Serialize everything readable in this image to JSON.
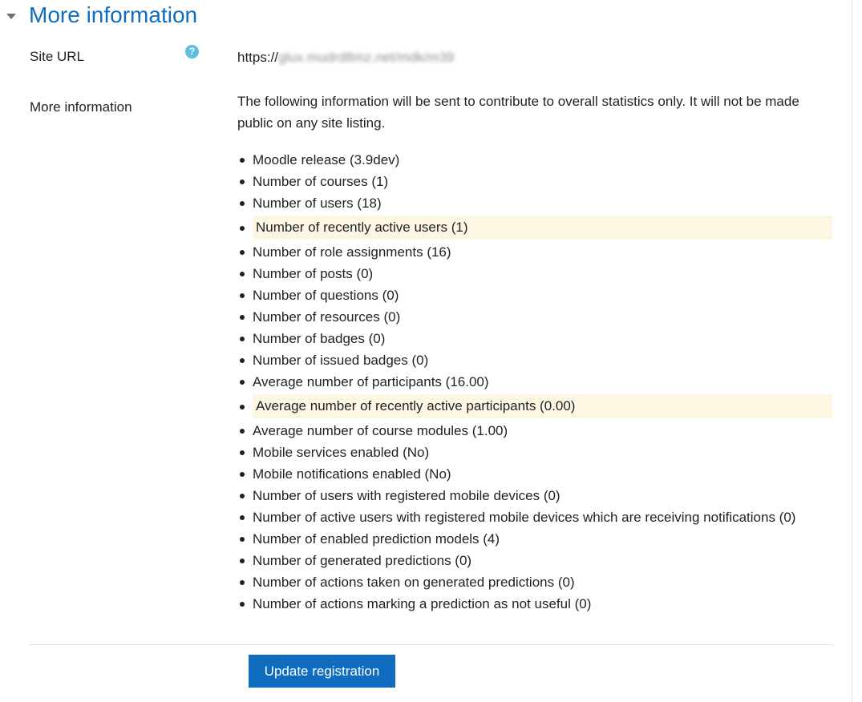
{
  "section": {
    "title": "More information"
  },
  "site_url": {
    "label": "Site URL",
    "prefix": "https://",
    "obscured": "glux.mudrd8mz.net/mdk/m39"
  },
  "more_info": {
    "label": "More information",
    "intro": "The following information will be sent to contribute to overall statistics only. It will not be made public on any site listing.",
    "items": [
      {
        "text": "Moodle release (3.9dev)",
        "highlight": false
      },
      {
        "text": "Number of courses (1)",
        "highlight": false
      },
      {
        "text": "Number of users (18)",
        "highlight": false
      },
      {
        "text": "Number of recently active users (1)",
        "highlight": true
      },
      {
        "text": "Number of role assignments (16)",
        "highlight": false
      },
      {
        "text": "Number of posts (0)",
        "highlight": false
      },
      {
        "text": "Number of questions (0)",
        "highlight": false
      },
      {
        "text": "Number of resources (0)",
        "highlight": false
      },
      {
        "text": "Number of badges (0)",
        "highlight": false
      },
      {
        "text": "Number of issued badges (0)",
        "highlight": false
      },
      {
        "text": "Average number of participants (16.00)",
        "highlight": false
      },
      {
        "text": "Average number of recently active participants (0.00)",
        "highlight": true
      },
      {
        "text": "Average number of course modules (1.00)",
        "highlight": false
      },
      {
        "text": "Mobile services enabled (No)",
        "highlight": false
      },
      {
        "text": "Mobile notifications enabled (No)",
        "highlight": false
      },
      {
        "text": "Number of users with registered mobile devices (0)",
        "highlight": false
      },
      {
        "text": "Number of active users with registered mobile devices which are receiving notifications (0)",
        "highlight": false
      },
      {
        "text": "Number of enabled prediction models (4)",
        "highlight": false
      },
      {
        "text": "Number of generated predictions (0)",
        "highlight": false
      },
      {
        "text": "Number of actions taken on generated predictions (0)",
        "highlight": false
      },
      {
        "text": "Number of actions marking a prediction as not useful (0)",
        "highlight": false
      }
    ]
  },
  "actions": {
    "update_label": "Update registration"
  },
  "icons": {
    "collapse": "caret-down-icon",
    "help": "help-icon",
    "help_glyph": "?"
  },
  "colors": {
    "accent": "#0f6cbf",
    "highlight": "#fcf6e3",
    "help": "#5bc0de"
  }
}
